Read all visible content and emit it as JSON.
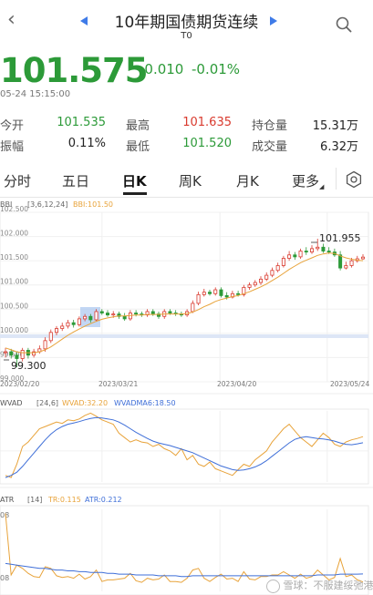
{
  "header": {
    "title": "10年期国债期货连续",
    "subtitle": "T0"
  },
  "quote": {
    "price": "101.575",
    "change": "-0.010",
    "change_pct": "-0.01%",
    "datetime": "05-24 15:15:00"
  },
  "stats": [
    {
      "label": "今开",
      "value": "101.535",
      "color": "green"
    },
    {
      "label": "最高",
      "value": "101.635",
      "color": "red"
    },
    {
      "label": "持仓量",
      "value": "15.31万",
      "color": "dark"
    },
    {
      "label": "振幅",
      "value": "0.11%",
      "color": "dark"
    },
    {
      "label": "最低",
      "value": "101.520",
      "color": "green"
    },
    {
      "label": "成交量",
      "value": "6.32万",
      "color": "dark"
    }
  ],
  "tabs": [
    "分时",
    "五日",
    "日K",
    "周K",
    "月K",
    "更多"
  ],
  "active_tab": "日K",
  "colors": {
    "up": "#d93a2e",
    "down": "#2c9a38",
    "bbi": "#e8a33a",
    "wvadma": "#3f6fd8",
    "accent": "#3f7be8"
  },
  "main_chart": {
    "indicator": "BBI",
    "params": "[3,6,12,24]",
    "indicator_value": "BBI:101.50",
    "y_ticks": [
      "102.500",
      "102.000",
      "101.500",
      "101.000",
      "100.500",
      "100.000",
      "99.500",
      "99.000"
    ],
    "x_ticks": [
      "2023/02/20",
      "2023/03/21",
      "2023/04/20",
      "2023/05/24"
    ],
    "high_label": "101.955",
    "low_label": "99.300"
  },
  "wvad_chart": {
    "name": "WVAD",
    "params": "[24,6]",
    "value": "WVAD:32.20",
    "ma_value": "WVADMA6:18.50"
  },
  "atr_chart": {
    "name": "ATR",
    "params": "[14]",
    "tr": "TR:0.115",
    "atr": "ATR:0.212",
    "y_top": "08",
    "y_bottom": "08"
  },
  "watermark": "雪球：不服建绥弛港股",
  "chart_data": {
    "type": "candlestick",
    "title": "",
    "ylim": [
      99.0,
      102.5
    ],
    "x": [
      "2023/02/20",
      "2023/02/21",
      "2023/02/22",
      "2023/02/23",
      "2023/02/24",
      "2023/02/27",
      "2023/02/28",
      "2023/03/01",
      "2023/03/02",
      "2023/03/03",
      "2023/03/06",
      "2023/03/07",
      "2023/03/08",
      "2023/03/09",
      "2023/03/10",
      "2023/03/13",
      "2023/03/14",
      "2023/03/15",
      "2023/03/16",
      "2023/03/17",
      "2023/03/20",
      "2023/03/21",
      "2023/03/22",
      "2023/03/23",
      "2023/03/24",
      "2023/03/27",
      "2023/03/28",
      "2023/03/29",
      "2023/03/30",
      "2023/03/31",
      "2023/04/03",
      "2023/04/04",
      "2023/04/06",
      "2023/04/07",
      "2023/04/10",
      "2023/04/11",
      "2023/04/12",
      "2023/04/13",
      "2023/04/14",
      "2023/04/17",
      "2023/04/18",
      "2023/04/19",
      "2023/04/20",
      "2023/04/21",
      "2023/04/24",
      "2023/04/25",
      "2023/04/26",
      "2023/04/27",
      "2023/04/28",
      "2023/05/04",
      "2023/05/05",
      "2023/05/08",
      "2023/05/09",
      "2023/05/10",
      "2023/05/11",
      "2023/05/12",
      "2023/05/15",
      "2023/05/16",
      "2023/05/17",
      "2023/05/18",
      "2023/05/19",
      "2023/05/22",
      "2023/05/23",
      "2023/05/24"
    ],
    "open": [
      99.6,
      99.62,
      99.55,
      99.48,
      99.65,
      99.55,
      99.62,
      99.68,
      99.85,
      100.02,
      100.1,
      100.15,
      100.22,
      100.18,
      100.3,
      100.35,
      100.28,
      100.45,
      100.42,
      100.38,
      100.4,
      100.35,
      100.3,
      100.42,
      100.4,
      100.38,
      100.45,
      100.4,
      100.35,
      100.45,
      100.42,
      100.4,
      100.38,
      100.45,
      100.62,
      100.8,
      100.85,
      100.82,
      100.9,
      100.78,
      100.75,
      100.82,
      100.8,
      100.95,
      101.0,
      101.05,
      101.12,
      101.2,
      101.3,
      101.4,
      101.55,
      101.62,
      101.58,
      101.7,
      101.68,
      101.75,
      101.78,
      101.7,
      101.68,
      101.62,
      101.35,
      101.4,
      101.5,
      101.54
    ],
    "close": [
      99.62,
      99.55,
      99.48,
      99.65,
      99.55,
      99.62,
      99.68,
      99.85,
      100.02,
      100.1,
      100.15,
      100.22,
      100.18,
      100.3,
      100.35,
      100.28,
      100.45,
      100.42,
      100.38,
      100.4,
      100.35,
      100.3,
      100.42,
      100.4,
      100.38,
      100.45,
      100.4,
      100.35,
      100.45,
      100.42,
      100.4,
      100.38,
      100.45,
      100.62,
      100.8,
      100.85,
      100.82,
      100.9,
      100.78,
      100.75,
      100.82,
      100.8,
      100.95,
      101.0,
      101.05,
      101.12,
      101.2,
      101.3,
      101.4,
      101.55,
      101.62,
      101.58,
      101.7,
      101.68,
      101.75,
      101.78,
      101.7,
      101.68,
      101.62,
      101.35,
      101.4,
      101.5,
      101.54,
      101.575
    ],
    "high": [
      99.7,
      99.68,
      99.62,
      99.7,
      99.7,
      99.68,
      99.75,
      99.92,
      100.08,
      100.15,
      100.22,
      100.28,
      100.28,
      100.35,
      100.4,
      100.4,
      100.5,
      100.5,
      100.48,
      100.46,
      100.45,
      100.42,
      100.48,
      100.48,
      100.45,
      100.5,
      100.5,
      100.45,
      100.5,
      100.5,
      100.48,
      100.45,
      100.5,
      100.68,
      100.86,
      100.92,
      100.9,
      100.95,
      100.95,
      100.85,
      100.88,
      100.88,
      101.0,
      101.05,
      101.1,
      101.18,
      101.26,
      101.36,
      101.46,
      101.6,
      101.7,
      101.68,
      101.75,
      101.78,
      101.82,
      101.955,
      101.85,
      101.78,
      101.75,
      101.7,
      101.48,
      101.56,
      101.6,
      101.635
    ],
    "low": [
      99.5,
      99.48,
      99.3,
      99.42,
      99.48,
      99.5,
      99.58,
      99.62,
      99.8,
      99.96,
      100.05,
      100.1,
      100.12,
      100.14,
      100.25,
      100.22,
      100.24,
      100.38,
      100.34,
      100.32,
      100.3,
      100.26,
      100.26,
      100.35,
      100.34,
      100.34,
      100.36,
      100.3,
      100.3,
      100.38,
      100.36,
      100.34,
      100.34,
      100.42,
      100.58,
      100.76,
      100.78,
      100.78,
      100.74,
      100.7,
      100.72,
      100.76,
      100.76,
      100.9,
      100.96,
      101.0,
      101.08,
      101.16,
      101.26,
      101.36,
      101.5,
      101.52,
      101.54,
      101.62,
      101.64,
      101.7,
      101.66,
      101.64,
      101.58,
      101.3,
      101.32,
      101.36,
      101.46,
      101.52
    ],
    "series": [
      {
        "name": "BBI",
        "values": [
          99.7,
          99.66,
          99.62,
          99.6,
          99.6,
          99.6,
          99.62,
          99.66,
          99.72,
          99.8,
          99.88,
          99.96,
          100.03,
          100.09,
          100.15,
          100.2,
          100.25,
          100.29,
          100.32,
          100.34,
          100.36,
          100.36,
          100.37,
          100.38,
          100.38,
          100.39,
          100.39,
          100.39,
          100.4,
          100.4,
          100.4,
          100.4,
          100.41,
          100.44,
          100.49,
          100.55,
          100.6,
          100.66,
          100.7,
          100.73,
          100.76,
          100.78,
          100.82,
          100.86,
          100.91,
          100.96,
          101.02,
          101.09,
          101.16,
          101.24,
          101.32,
          101.39,
          101.46,
          101.51,
          101.56,
          101.61,
          101.64,
          101.66,
          101.65,
          101.6,
          101.56,
          101.53,
          101.51,
          101.5
        ]
      }
    ],
    "wvad": {
      "ylim": [
        -70,
        90
      ],
      "WVAD": [
        -55,
        -60,
        -30,
        10,
        20,
        35,
        50,
        55,
        60,
        65,
        62,
        70,
        68,
        72,
        80,
        85,
        78,
        70,
        65,
        60,
        40,
        30,
        20,
        25,
        20,
        18,
        10,
        15,
        5,
        0,
        -10,
        5,
        -20,
        -10,
        -30,
        -35,
        -25,
        -40,
        -45,
        -50,
        -55,
        -42,
        -30,
        -35,
        -20,
        -10,
        0,
        20,
        35,
        50,
        60,
        45,
        30,
        20,
        10,
        25,
        40,
        30,
        15,
        10,
        20,
        25,
        28,
        32.2
      ],
      "WVADMA6": [
        -60,
        -55,
        -48,
        -35,
        -20,
        -5,
        10,
        25,
        38,
        48,
        55,
        60,
        63,
        66,
        70,
        73,
        75,
        74,
        72,
        70,
        65,
        58,
        50,
        42,
        35,
        28,
        22,
        18,
        15,
        12,
        8,
        4,
        0,
        -4,
        -10,
        -16,
        -22,
        -28,
        -34,
        -38,
        -42,
        -44,
        -43,
        -40,
        -36,
        -30,
        -22,
        -12,
        -2,
        8,
        18,
        26,
        30,
        32,
        30,
        28,
        27,
        25,
        22,
        18,
        15,
        14,
        16,
        18.5
      ]
    },
    "atr": {
      "ylim": [
        0.0,
        1.0
      ],
      "TR": [
        0.95,
        0.2,
        0.32,
        0.28,
        0.22,
        0.18,
        0.17,
        0.3,
        0.28,
        0.19,
        0.17,
        0.18,
        0.16,
        0.21,
        0.15,
        0.18,
        0.26,
        0.12,
        0.14,
        0.14,
        0.15,
        0.16,
        0.22,
        0.13,
        0.11,
        0.16,
        0.14,
        0.15,
        0.2,
        0.12,
        0.12,
        0.11,
        0.16,
        0.26,
        0.28,
        0.16,
        0.12,
        0.17,
        0.21,
        0.15,
        0.16,
        0.12,
        0.24,
        0.15,
        0.14,
        0.18,
        0.18,
        0.2,
        0.2,
        0.24,
        0.2,
        0.16,
        0.21,
        0.16,
        0.18,
        0.26,
        0.2,
        0.14,
        0.17,
        0.4,
        0.18,
        0.2,
        0.14,
        0.115
      ],
      "ATR": [
        0.34,
        0.33,
        0.32,
        0.31,
        0.3,
        0.29,
        0.28,
        0.28,
        0.27,
        0.26,
        0.26,
        0.25,
        0.25,
        0.24,
        0.24,
        0.23,
        0.23,
        0.23,
        0.22,
        0.22,
        0.21,
        0.21,
        0.21,
        0.2,
        0.2,
        0.2,
        0.2,
        0.19,
        0.19,
        0.19,
        0.19,
        0.18,
        0.18,
        0.19,
        0.19,
        0.19,
        0.19,
        0.19,
        0.19,
        0.19,
        0.19,
        0.19,
        0.19,
        0.19,
        0.19,
        0.19,
        0.19,
        0.19,
        0.19,
        0.19,
        0.19,
        0.19,
        0.19,
        0.19,
        0.19,
        0.2,
        0.2,
        0.2,
        0.2,
        0.21,
        0.21,
        0.21,
        0.21,
        0.212
      ]
    }
  }
}
